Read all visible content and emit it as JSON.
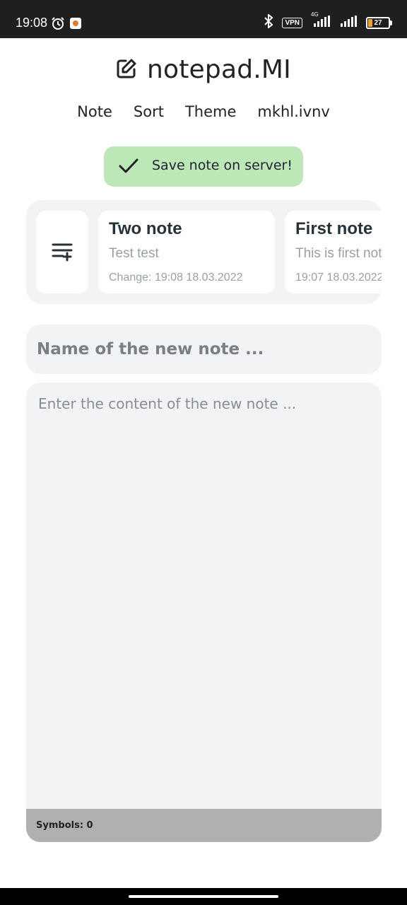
{
  "status_bar": {
    "time": "19:08",
    "vpn": "VPN",
    "network": "4G",
    "battery": "27",
    "icons": [
      "alarm-icon",
      "app-notification-icon",
      "bluetooth-icon",
      "vpn-icon",
      "signal-icon",
      "signal-icon",
      "battery-icon"
    ]
  },
  "header": {
    "title": "notepad.MI",
    "icon": "edit-icon"
  },
  "nav": {
    "note": "Note",
    "sort": "Sort",
    "theme": "Theme",
    "user": "mkhl.ivnv"
  },
  "toast": {
    "label": "Save note on server!",
    "icon": "check-icon",
    "color": "#bde9b8"
  },
  "notes": {
    "add_icon": "add-list-icon",
    "items": [
      {
        "title": "Two note",
        "body": "Test test",
        "date": "Change: 19:08 18.03.2022"
      },
      {
        "title": "First note",
        "body": "This is first note",
        "date": "19:07 18.03.2022"
      }
    ]
  },
  "editor": {
    "name_placeholder": "Name of the new note ...",
    "content_placeholder": "Enter the content of the new note ...",
    "symbols": "Symbols: 0"
  }
}
